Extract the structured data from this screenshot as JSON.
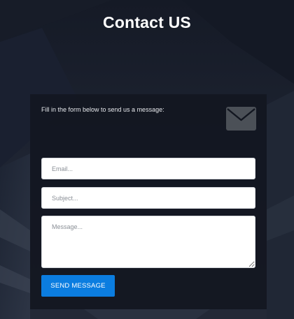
{
  "page": {
    "title": "Contact US"
  },
  "form": {
    "intro": "Fill in the form below to send us a message:",
    "icon": "envelope-icon",
    "email": {
      "value": "",
      "placeholder": "Email..."
    },
    "subject": {
      "value": "",
      "placeholder": "Subject..."
    },
    "message": {
      "value": "",
      "placeholder": "Message..."
    },
    "submit_label": "SEND MESSAGE"
  },
  "colors": {
    "background": "#1c2230",
    "panel": "#121620",
    "button": "#0b7de0",
    "icon": "#4b5057",
    "title_text": "#ffffff"
  }
}
